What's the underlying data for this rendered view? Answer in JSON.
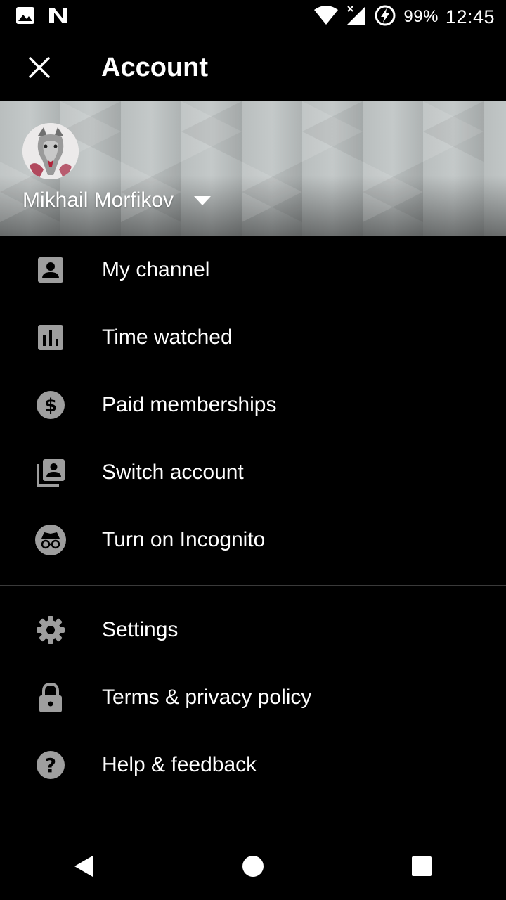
{
  "status_bar": {
    "left_icons": [
      "image-icon",
      "n-app-icon"
    ],
    "battery_percent": "99%",
    "time": "12:45"
  },
  "app_bar": {
    "title": "Account",
    "close_icon": "close-icon"
  },
  "account": {
    "name": "Mikhail Morfikov"
  },
  "menu": {
    "primary": [
      {
        "label": "My channel",
        "icon": "person-box-icon"
      },
      {
        "label": "Time watched",
        "icon": "bar-chart-icon"
      },
      {
        "label": "Paid memberships",
        "icon": "dollar-circle-icon"
      },
      {
        "label": "Switch account",
        "icon": "switch-account-icon"
      },
      {
        "label": "Turn on Incognito",
        "icon": "incognito-icon"
      }
    ],
    "secondary": [
      {
        "label": "Settings",
        "icon": "gear-icon"
      },
      {
        "label": "Terms & privacy policy",
        "icon": "lock-icon"
      },
      {
        "label": "Help & feedback",
        "icon": "help-icon"
      }
    ]
  },
  "colors": {
    "background": "#000000",
    "text": "#ffffff",
    "icon": "#9e9e9e",
    "divider": "#3a3a3a"
  }
}
